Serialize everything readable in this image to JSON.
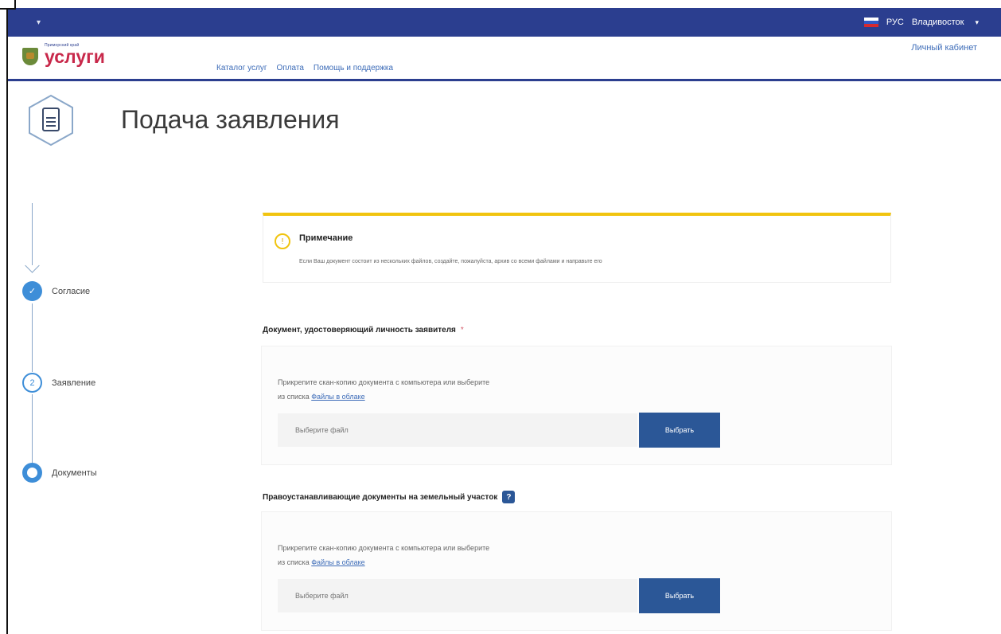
{
  "topbar": {
    "language": "РУС",
    "city": "Владивосток"
  },
  "header": {
    "logo_small": "Приморский край",
    "logo_big": "услуги",
    "nav": [
      "Каталог услуг",
      "Оплата",
      "Помощь и поддержка"
    ],
    "cabinet": "Личный кабинет"
  },
  "page": {
    "title": "Подача заявления"
  },
  "steps": [
    {
      "label": "Согласие",
      "state": "done",
      "mark": "✓"
    },
    {
      "label": "Заявление",
      "state": "numbered",
      "mark": "2"
    },
    {
      "label": "Документы",
      "state": "current",
      "mark": ""
    }
  ],
  "note": {
    "title": "Примечание",
    "text": "Если Ваш документ состоит из нескольких файлов, создайте, пожалуйста, архив со всеми файлами и направьте его"
  },
  "documents": [
    {
      "title": "Документ, удостоверяющий личность заявителя",
      "required_mark": "*",
      "text_line1": "Прикрепите скан-копию документа с компьютера или выберите",
      "text_prefix": "из списка",
      "link": "Файлы в облаке",
      "placeholder": "Выберите файл",
      "button": "Выбрать"
    },
    {
      "title": "Правоустанавливающие документы на земельный участок",
      "help": "?",
      "text_line1": "Прикрепите скан-копию документа с компьютера или выберите",
      "text_prefix": "из списка",
      "link": "Файлы в облаке",
      "placeholder": "Выберите файл",
      "button": "Выбрать"
    }
  ],
  "colors": {
    "brand_blue": "#2b3e8f",
    "accent_yellow": "#f1c40f",
    "button_blue": "#2b5797",
    "logo_red": "#c8284a"
  }
}
